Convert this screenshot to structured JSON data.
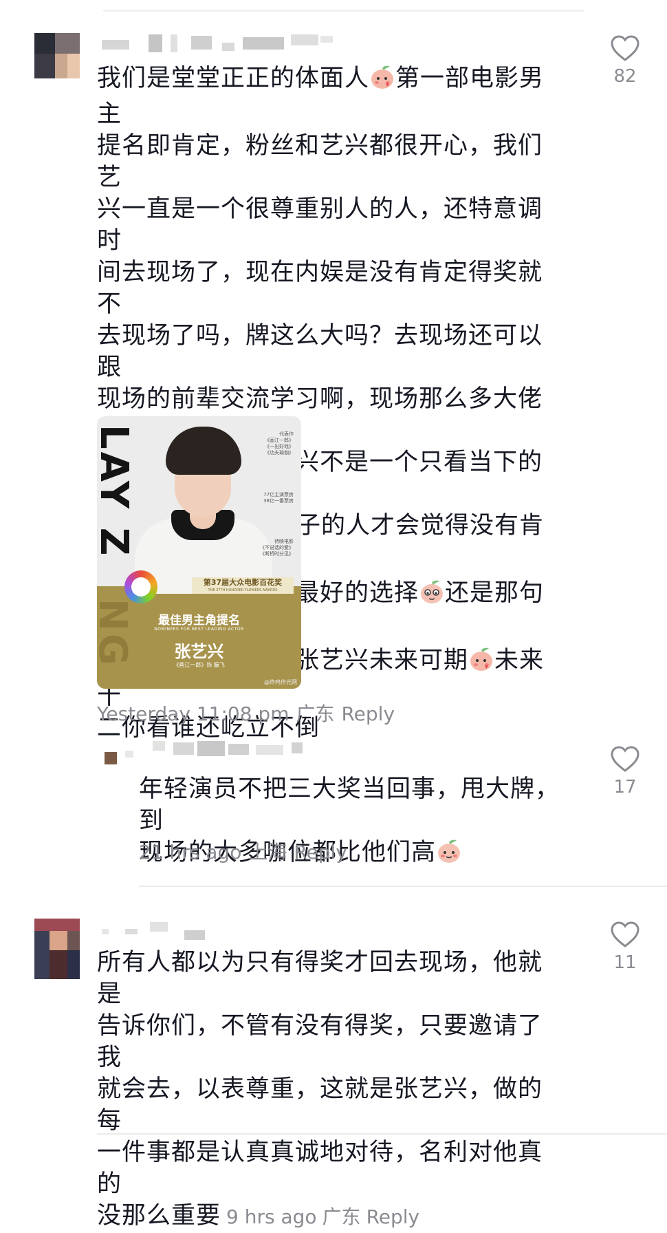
{
  "comments": [
    {
      "text": "我们是堂堂正正的体面人\u0001第一部电影男主\n提名即肯定，粉丝和艺兴都很开心，我们艺\n兴一直是一个很尊重别人的人，还特意调时\n间去现场了，现在内娱是没有肯定得奖就不\n去现场了吗，牌这么大吗？去现场还可以跟\n现场的前辈交流学习啊，现场那么多大佬不\n去不可惜？我们艺兴不是一个只看当下的人\n哦\u0001目光短浅没脑子的人才会觉得没有肯定\n拿奖的情况不去是最好的选择\u0002还是那句话\n提名即肯定，演员张艺兴未来可期\u0001未来十\n二你看谁还屹立不倒",
      "line1": "我们是堂堂正正的体面人",
      "line1b": "第一部电影男主",
      "lines_mid": "提名即肯定，粉丝和艺兴都很开心，我们艺\n兴一直是一个很尊重别人的人，还特意调时\n间去现场了，现在内娱是没有肯定得奖就不\n去现场了吗，牌这么大吗？去现场还可以跟\n现场的前辈交流学习啊，现场那么多大佬不\n去不可惜？我们艺兴不是一个只看当下的人",
      "line8a": "哦",
      "line8b": "目光短浅没脑子的人才会觉得没有肯定",
      "line9a": "拿奖的情况不去是最好的选择",
      "line9b": "还是那句话",
      "line10a": "提名即肯定，演员张艺兴未来可期",
      "line10b": "未来十",
      "line11": "二你看谁还屹立不倒",
      "time": "Yesterday 11:08 pm",
      "location": "广东",
      "reply": "Reply",
      "likes": "82"
    },
    {
      "line1": "年轻演员不把三大奖当回事，甩大牌，到",
      "line2": "现场的大多咖位都比他们高",
      "time": "21 hrs ago",
      "location": "上海",
      "reply": "Reply",
      "likes": "17"
    },
    {
      "line1": "所有人都以为只有得奖才回去现场，他就是",
      "line2": "告诉你们，不管有没有得奖，只要邀请了我",
      "line3": "就会去，以表尊重，这就是张艺兴，做的每",
      "line4": "一件事都是认真真诚地对待，名利对他真的",
      "line5": "没那么重要",
      "time": "9 hrs ago",
      "location": "广东",
      "reply": "Reply",
      "likes": "11"
    }
  ],
  "poster": {
    "vertical_name_top": "LAY Z",
    "vertical_name_bottom": "NG",
    "works_label": "代表作",
    "works": "《画江一郎》\n《一出好戏》\n《功夫瑜伽》",
    "box_office": "77亿主演票房\n38亿一番票房",
    "upcoming_label": "待映电影",
    "upcoming": "《不说话的爱》\n《断桥时分见》",
    "award_title": "第37届大众电影百花奖",
    "award_title_en": "THE 37TH HUNDRED FLOWERS AWARDS",
    "category": "最佳男主角提名",
    "category_en": "NOMINEES FOR BEST LEADING ACTOR",
    "actor": "张艺兴",
    "role": "《画江一郎》饰 滕飞",
    "watermark": "@炸鸡作光网"
  },
  "icons": {
    "like": "heart-outline-icon",
    "emoji": "peach-face-emoji-icon"
  },
  "colors": {
    "text": "#161823",
    "meta": "#8a8b91",
    "divider": "#ececec",
    "poster_gold": "#a8934d"
  }
}
